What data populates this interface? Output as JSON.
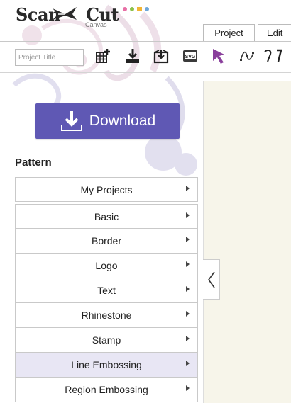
{
  "app": {
    "logo_main": "Scan",
    "logo_cut": "Cut",
    "logo_sub": "Canvas"
  },
  "tabs": [
    {
      "label": "Project"
    },
    {
      "label": "Edit"
    }
  ],
  "toolbar": {
    "project_title_placeholder": "Project Title",
    "svg_label": "SVG"
  },
  "download": {
    "label": "Download"
  },
  "pattern": {
    "title": "Pattern",
    "items": [
      {
        "label": "My Projects"
      },
      {
        "label": "Basic"
      },
      {
        "label": "Border"
      },
      {
        "label": "Logo"
      },
      {
        "label": "Text"
      },
      {
        "label": "Rhinestone"
      },
      {
        "label": "Stamp"
      },
      {
        "label": "Line Embossing"
      },
      {
        "label": "Region Embossing"
      }
    ],
    "selected": "Line Embossing"
  },
  "colors": {
    "accent": "#5f58b4",
    "selected_row": "#e8e6f4",
    "canvas": "#f7f5ea",
    "select_tool": "#8a3f9c"
  },
  "icons": [
    "add-grid-icon",
    "import-icon",
    "save-icon",
    "svg-file-icon",
    "select-arrow-icon",
    "node-edit-icon",
    "curve-tool-icon",
    "download-icon",
    "collapse-chevron-icon"
  ]
}
